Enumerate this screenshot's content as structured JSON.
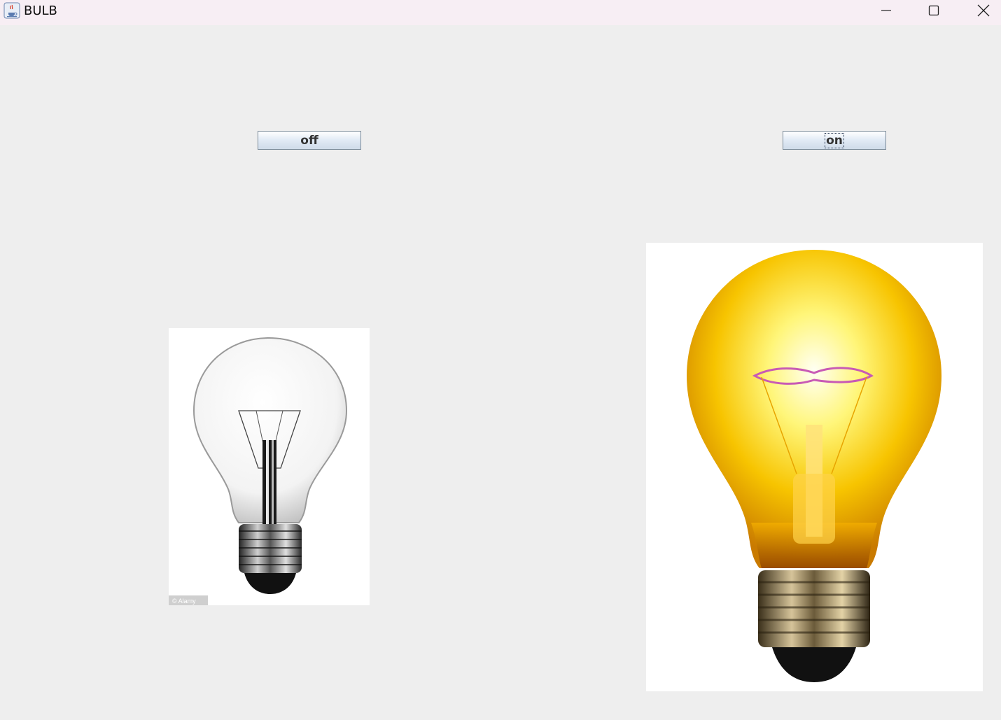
{
  "window": {
    "title": "BULB"
  },
  "buttons": {
    "off_label": "off",
    "on_label": "on"
  },
  "images": {
    "off_bulb_watermark": "© Alamy"
  },
  "icons": {
    "app": "java-coffee-icon",
    "minimize": "minimize-icon",
    "maximize": "maximize-icon",
    "close": "close-icon"
  },
  "colors": {
    "window_background": "#eeeeee",
    "titlebar_background": "#f7eef4",
    "button_border": "#7a8a99",
    "bulb_glow": "#f7c400"
  }
}
